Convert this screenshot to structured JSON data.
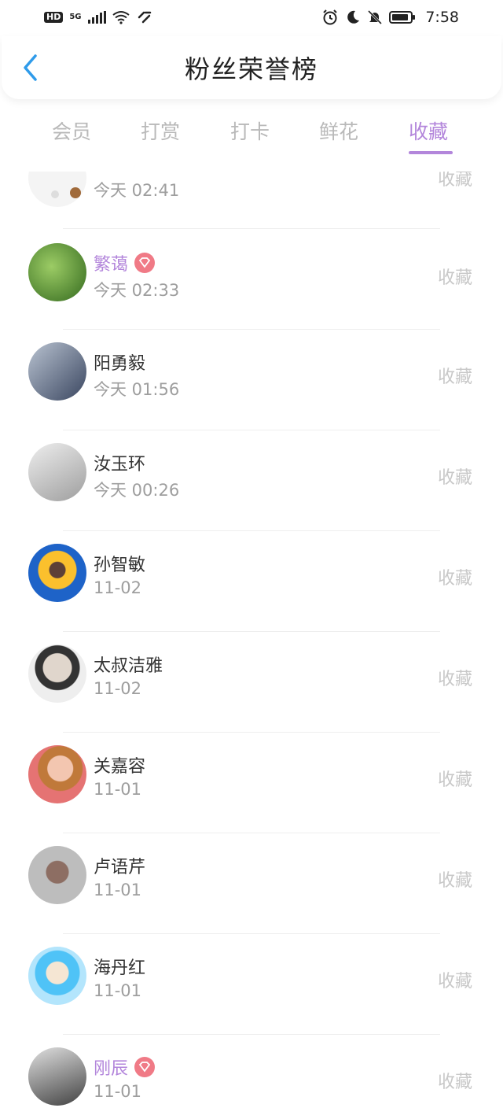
{
  "status": {
    "network": "5G",
    "hd": "HD",
    "time": "7:58"
  },
  "header": {
    "title": "粉丝荣誉榜"
  },
  "tabs": [
    {
      "label": "会员"
    },
    {
      "label": "打赏"
    },
    {
      "label": "打卡"
    },
    {
      "label": "鲜花"
    },
    {
      "label": "收藏"
    }
  ],
  "active_tab": "收藏",
  "list": {
    "action_label": "收藏",
    "items": [
      {
        "name": "",
        "date": "今天 02:41",
        "vip": false
      },
      {
        "name": "繁蔼",
        "date": "今天 02:33",
        "vip": true
      },
      {
        "name": "阳勇毅",
        "date": "今天 01:56",
        "vip": false
      },
      {
        "name": "汝玉环",
        "date": "今天 00:26",
        "vip": false
      },
      {
        "name": "孙智敏",
        "date": "11-02",
        "vip": false
      },
      {
        "name": "太叔洁雅",
        "date": "11-02",
        "vip": false
      },
      {
        "name": "关嘉容",
        "date": "11-01",
        "vip": false
      },
      {
        "name": "卢语芹",
        "date": "11-01",
        "vip": false
      },
      {
        "name": "海丹红",
        "date": "11-01",
        "vip": false
      },
      {
        "name": "刚辰",
        "date": "11-01",
        "vip": true
      }
    ]
  },
  "colors": {
    "accent": "#b386db",
    "back": "#2f9bea",
    "vip": "#f07a86"
  }
}
